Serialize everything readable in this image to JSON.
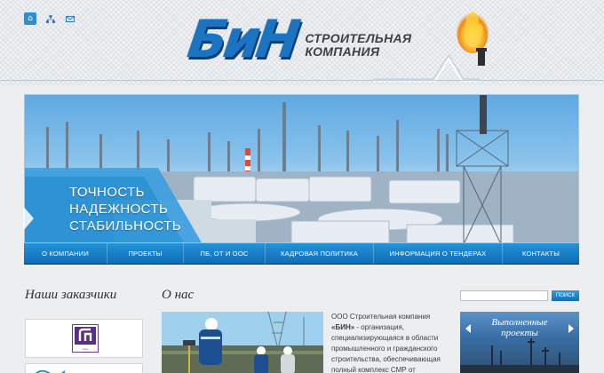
{
  "header": {
    "icons": [
      "home-icon",
      "sitemap-icon",
      "mail-icon"
    ],
    "logo_mark": "БиН",
    "logo_line1": "СТРОИТЕЛЬНАЯ",
    "logo_line2": "КОМПАНИЯ"
  },
  "banner": {
    "slogan": [
      "ТОЧНОСТЬ",
      "НАДЕЖНОСТЬ",
      "СТАБИЛЬНОСТЬ"
    ]
  },
  "nav": {
    "items": [
      "О КОМПАНИИ",
      "ПРОЕКТЫ",
      "ПБ, ОТ и ООС",
      "КАДРОВАЯ ПОЛИТИКА",
      "ИНФОРМАЦИЯ О ТЕНДЕРАХ",
      "КОНТАКТЫ"
    ]
  },
  "customers": {
    "title": "Наши заказчики"
  },
  "about": {
    "title": "О нас",
    "text_line1": "ООО Строительная компания",
    "text_company": "«БИН»",
    "text_line2_rest": " - организация,",
    "text_line3": "специализирующаяся в области",
    "text_line4": "промышленного и гражданского",
    "text_line5": "строительства, обеспечивающая",
    "text_line6": "полный комплекс СМР от"
  },
  "search": {
    "placeholder": "",
    "button_label": "поиск"
  },
  "projects_widget": {
    "title_line1": "Выполненные",
    "title_line2": "проекты"
  },
  "colors": {
    "brand_blue": "#1b74c2",
    "nav_blue": "#1a82cb",
    "page_bg": "#eceef0"
  }
}
